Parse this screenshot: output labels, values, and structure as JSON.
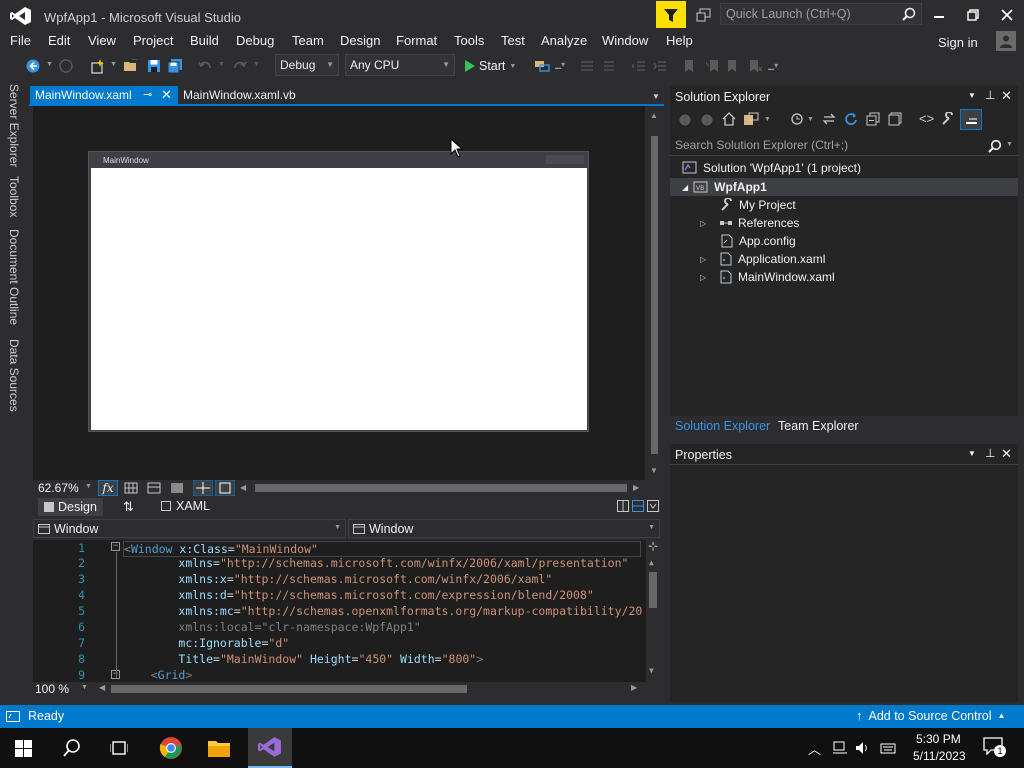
{
  "window": {
    "title": "WpfApp1 - Microsoft Visual Studio",
    "quick_launch_placeholder": "Quick Launch (Ctrl+Q)"
  },
  "menu": [
    "File",
    "Edit",
    "View",
    "Project",
    "Build",
    "Debug",
    "Team",
    "Design",
    "Format",
    "Tools",
    "Test",
    "Analyze",
    "Window",
    "Help"
  ],
  "account": {
    "sign_in": "Sign in"
  },
  "toolbar": {
    "config": "Debug",
    "platform": "Any CPU",
    "start": "Start"
  },
  "left_tabs": [
    "Server Explorer",
    "Toolbox",
    "Document Outline",
    "Data Sources"
  ],
  "doc_tabs": [
    {
      "label": "MainWindow.xaml",
      "active": true
    },
    {
      "label": "MainWindow.xaml.vb",
      "active": false
    }
  ],
  "designer": {
    "window_caption": "MainWindow",
    "zoom": "62.67%",
    "fx": "fx"
  },
  "view_tabs": {
    "design": "Design",
    "swap": "⇅",
    "xaml": "XAML"
  },
  "nav": {
    "left": "Window",
    "right": "Window"
  },
  "code": {
    "lines": [
      {
        "n": "1",
        "html": "<span class='t-g'>&lt;</span><span class='t-b'>Window</span> <span class='t-a'>x:Class</span>=<span class='t-v'>\"MainWindow\"</span>"
      },
      {
        "n": "2",
        "html": "        <span class='t-a'>xmlns</span>=<span class='t-v'>\"http://schemas.microsoft.com/winfx/2006/xaml/presentation\"</span>"
      },
      {
        "n": "3",
        "html": "        <span class='t-a'>xmlns:x</span>=<span class='t-v'>\"http://schemas.microsoft.com/winfx/2006/xaml\"</span>"
      },
      {
        "n": "4",
        "html": "        <span class='t-a'>xmlns:d</span>=<span class='t-v'>\"http://schemas.microsoft.com/expression/blend/2008\"</span>"
      },
      {
        "n": "5",
        "html": "        <span class='t-a'>xmlns:mc</span>=<span class='t-v'>\"http://schemas.openxmlformats.org/markup-compatibility/20</span>"
      },
      {
        "n": "6",
        "html": "        <span class='t-g'>xmlns:local=\"clr-namespace:WpfApp1\"</span>"
      },
      {
        "n": "7",
        "html": "        <span class='t-a'>mc:Ignorable</span>=<span class='t-v'>\"d\"</span>"
      },
      {
        "n": "8",
        "html": "        <span class='t-a'>Title</span>=<span class='t-v'>\"MainWindow\"</span> <span class='t-a'>Height</span>=<span class='t-v'>\"450\"</span> <span class='t-a'>Width</span>=<span class='t-v'>\"800\"</span><span class='t-g'>&gt;</span>"
      },
      {
        "n": "9",
        "html": "    <span class='t-g'>&lt;</span><span class='t-b'>Grid</span><span class='t-g'>&gt;</span>"
      }
    ],
    "zoom": "100 %"
  },
  "solution_explorer": {
    "title": "Solution Explorer",
    "search_placeholder": "Search Solution Explorer (Ctrl+;)",
    "tree": [
      {
        "label": "Solution 'WpfApp1' (1 project)"
      },
      {
        "label": "WpfApp1"
      },
      {
        "label": "My Project"
      },
      {
        "label": "References"
      },
      {
        "label": "App.config"
      },
      {
        "label": "Application.xaml"
      },
      {
        "label": "MainWindow.xaml"
      }
    ],
    "bottom_tabs": [
      "Solution Explorer",
      "Team Explorer"
    ]
  },
  "properties": {
    "title": "Properties"
  },
  "status": {
    "text": "Ready",
    "source_control": "Add to Source Control"
  },
  "taskbar": {
    "time": "5:30 PM",
    "date": "5/11/2023",
    "notif_count": "1"
  },
  "colors": {
    "accent": "#007acc",
    "vs_purple": "#68217a",
    "editor_bg": "#1e1e1e"
  }
}
